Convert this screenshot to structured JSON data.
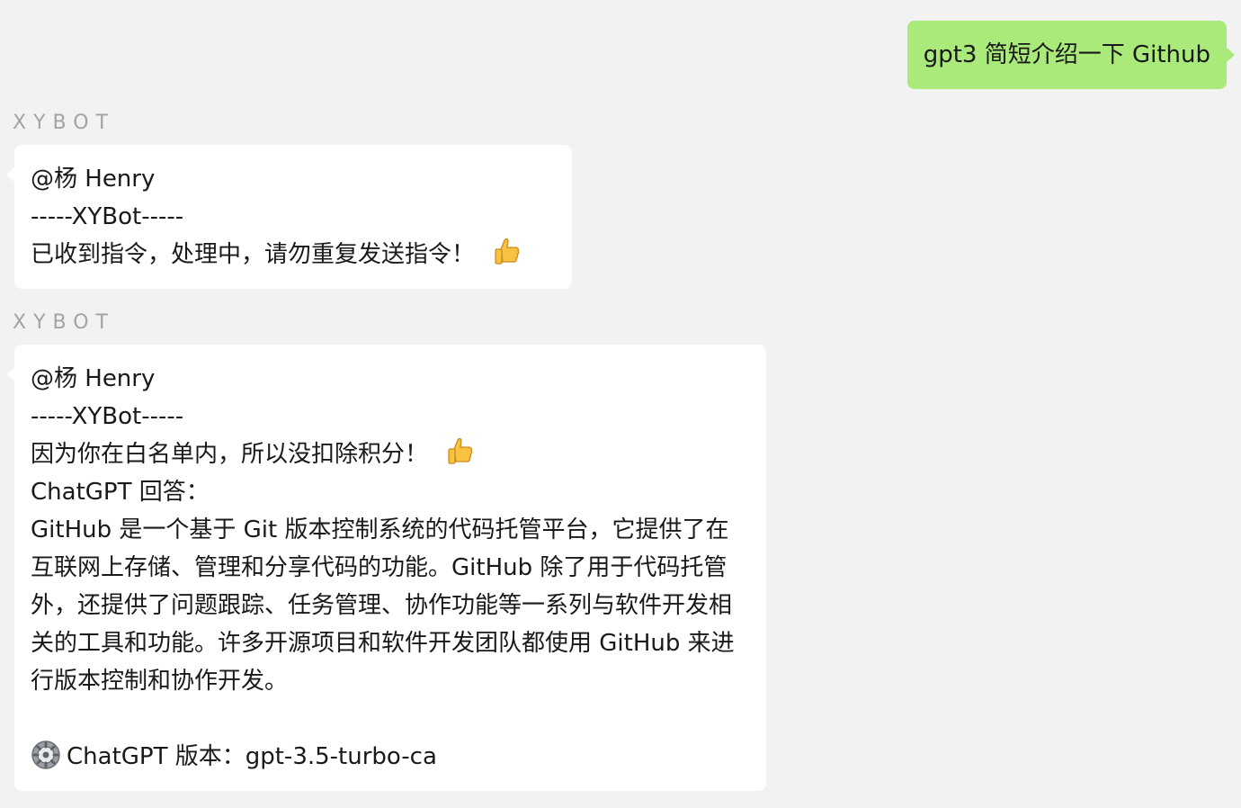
{
  "outgoing_message": {
    "text": "gpt3 简短介绍一下 Github"
  },
  "messages": [
    {
      "sender": "XYBOT",
      "mention": "@杨 Henry",
      "divider": "-----XYBot-----",
      "status": "已收到指令，处理中，请勿重复发送指令！",
      "status_icon": "thumbs-up-emoji"
    },
    {
      "sender": "XYBOT",
      "mention": "@杨 Henry",
      "divider": "-----XYBot-----",
      "status": "因为你在白名单内，所以没扣除积分！",
      "status_icon": "thumbs-up-emoji",
      "answer_header": "ChatGPT 回答：",
      "answer_body": "GitHub 是一个基于 Git 版本控制系统的代码托管平台，它提供了在互联网上存储、管理和分享代码的功能。GitHub 除了用于代码托管外，还提供了问题跟踪、任务管理、协作功能等一系列与软件开发相关的工具和功能。许多开源项目和软件开发团队都使用 GitHub 来进行版本控制和协作开发。",
      "version_icon": "gear-emoji",
      "version_text": "ChatGPT 版本：gpt-3.5-turbo-ca"
    }
  ],
  "colors": {
    "background": "#f2f2f2",
    "outgoing_bubble": "#a9ea7a",
    "incoming_bubble": "#ffffff",
    "sender_label": "#a3a3a3"
  }
}
